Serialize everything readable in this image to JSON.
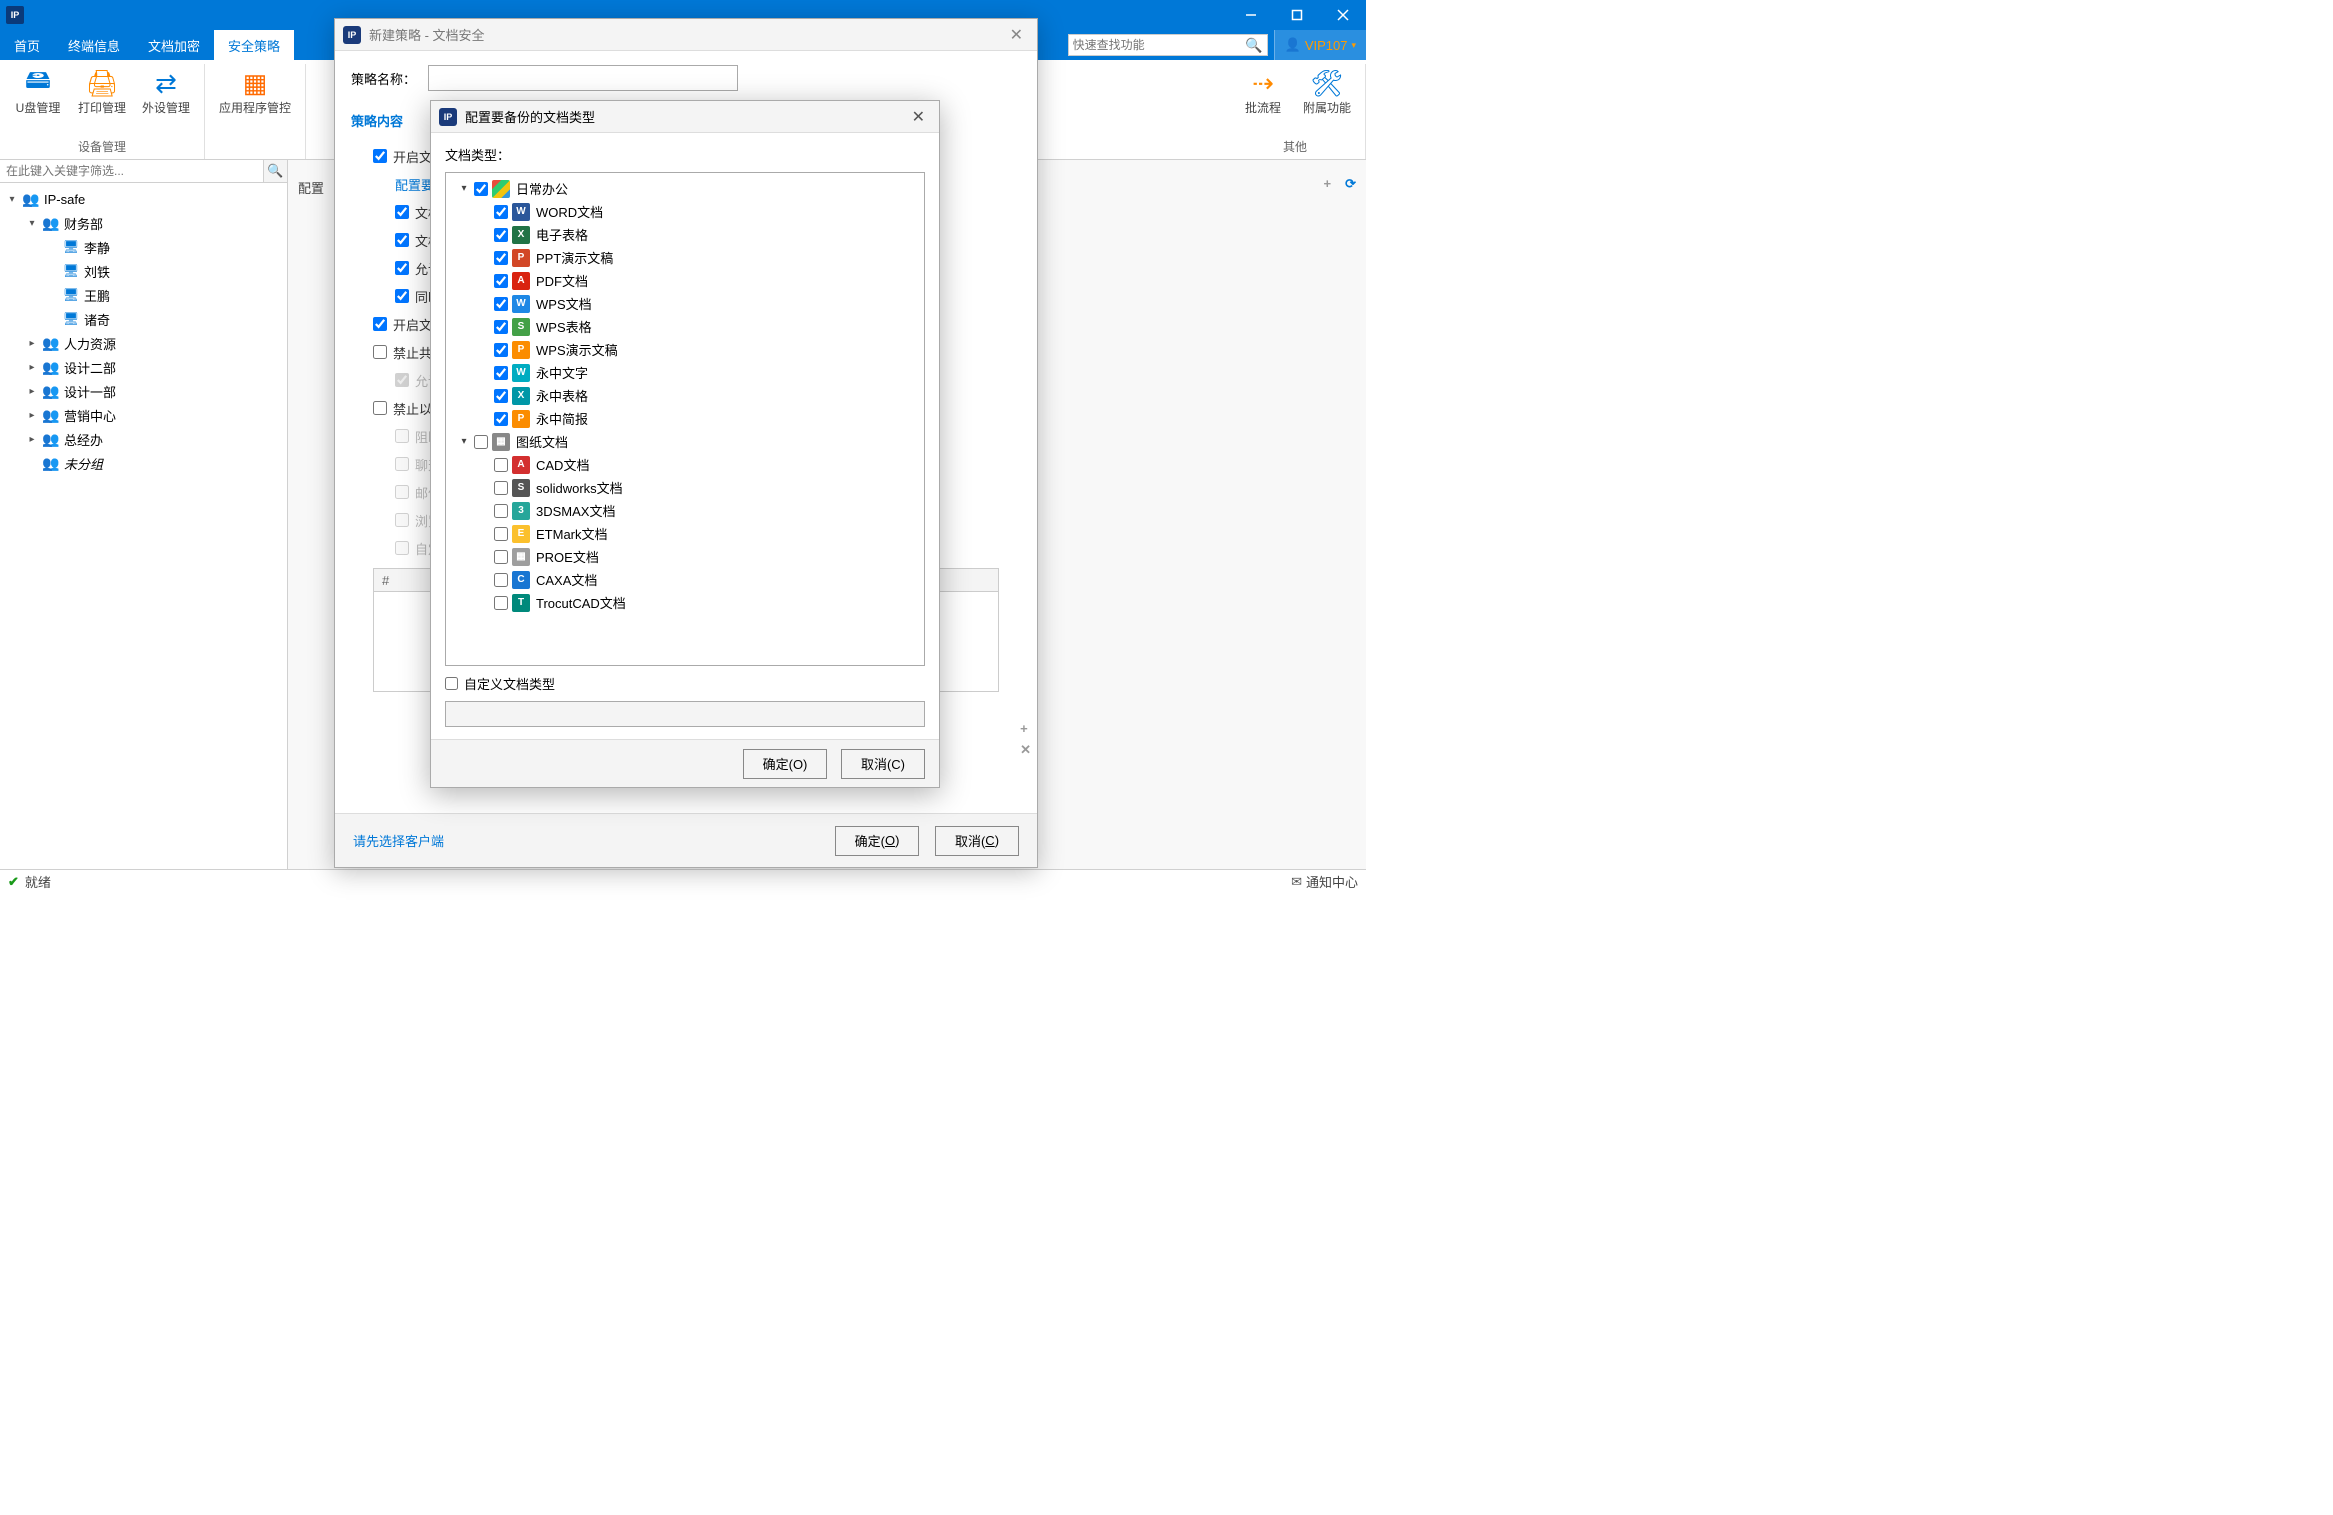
{
  "app": {
    "icon_text": "IP"
  },
  "menu": {
    "tabs": [
      "首页",
      "终端信息",
      "文档加密",
      "安全策略"
    ],
    "active_index": 3,
    "search_placeholder": "快速查找功能",
    "user": "VIP107"
  },
  "ribbon": {
    "groups": [
      {
        "label": "设备管理",
        "items": [
          {
            "icon": "🖴",
            "label": "U盘管理",
            "color": "#0078d7"
          },
          {
            "icon": "🖨",
            "label": "打印管理",
            "color": "#ff8a00"
          },
          {
            "icon": "⇄",
            "label": "外设管理",
            "color": "#0078d7"
          }
        ]
      },
      {
        "label": "",
        "items": [
          {
            "icon": "▦",
            "label": "应用程序管控",
            "color": "#ff6a00"
          }
        ],
        "cut": true
      },
      {
        "label": "其他",
        "items": [
          {
            "icon": "⇢",
            "label": "批流程",
            "color": "#ff8a00",
            "partial": true
          },
          {
            "icon": "🛠",
            "label": "附属功能",
            "color": "#0078d7"
          }
        ],
        "right": true
      }
    ]
  },
  "filter_placeholder": "在此键入关键字筛选...",
  "tree": {
    "root": "IP-safe",
    "root_children": [
      {
        "name": "财务部",
        "expanded": true,
        "children": [
          "李静",
          "刘铁",
          "王鹏",
          "诸奇"
        ]
      },
      {
        "name": "人力资源"
      },
      {
        "name": "设计二部"
      },
      {
        "name": "设计一部"
      },
      {
        "name": "营销中心"
      },
      {
        "name": "总经办"
      },
      {
        "name": "未分组",
        "italic": true,
        "no_twisty": true
      }
    ]
  },
  "center": {
    "cfg_label": "配置",
    "plus": "+",
    "refresh": "⟳"
  },
  "status": {
    "ready": "就绪",
    "notify": "通知中心"
  },
  "outer_modal": {
    "title": "新建策略 - 文档安全",
    "name_label": "策略名称：",
    "section": "策略内容",
    "rows": [
      {
        "lvl": 1,
        "checked": true,
        "text": "开启文"
      },
      {
        "lvl": 2,
        "link": true,
        "text": "配置要备"
      },
      {
        "lvl": 2,
        "checked": true,
        "text": "文档"
      },
      {
        "lvl": 2,
        "checked": true,
        "text": "文档"
      },
      {
        "lvl": 2,
        "checked": true,
        "text": "允许"
      },
      {
        "lvl": 2,
        "checked": true,
        "text": "同时"
      },
      {
        "lvl": 1,
        "checked": true,
        "text": "开启文"
      },
      {
        "lvl": 1,
        "checked": false,
        "text": "禁止共"
      },
      {
        "lvl": 2,
        "checked": true,
        "disabled": true,
        "text": "允许"
      },
      {
        "lvl": 1,
        "checked": false,
        "text": "禁止以"
      },
      {
        "lvl": 2,
        "checked": false,
        "disabled": true,
        "text": "阻断"
      },
      {
        "lvl": 2,
        "checked": false,
        "disabled": true,
        "text": "聊天"
      },
      {
        "lvl": 2,
        "checked": false,
        "disabled": true,
        "text": "邮件"
      },
      {
        "lvl": 2,
        "checked": false,
        "disabled": true,
        "text": "浏览"
      },
      {
        "lvl": 2,
        "checked": false,
        "disabled": true,
        "text": "自定"
      }
    ],
    "table_header": "#",
    "footer_hint": "请先选择客户端",
    "ok": "确定(",
    "ok_u": "O",
    "ok2": ")",
    "cancel": "取消(",
    "cancel_u": "C",
    "cancel2": ")"
  },
  "inner_modal": {
    "title": "配置要备份的文档类型",
    "label": "文档类型：",
    "custom_label": "自定义文档类型",
    "ok": "确定(O)",
    "cancel": "取消(C)",
    "nodes": [
      {
        "depth": 0,
        "twisty": "▾",
        "checked": true,
        "icon": "ic-multi",
        "text": "日常办公"
      },
      {
        "depth": 1,
        "checked": true,
        "icon": "ic-word",
        "glyph": "W",
        "text": "WORD文档"
      },
      {
        "depth": 1,
        "checked": true,
        "icon": "ic-xls",
        "glyph": "X",
        "text": "电子表格"
      },
      {
        "depth": 1,
        "checked": true,
        "icon": "ic-ppt",
        "glyph": "P",
        "text": "PPT演示文稿"
      },
      {
        "depth": 1,
        "checked": true,
        "icon": "ic-pdf",
        "glyph": "A",
        "text": "PDF文档"
      },
      {
        "depth": 1,
        "checked": true,
        "icon": "ic-wps",
        "glyph": "W",
        "text": "WPS文档"
      },
      {
        "depth": 1,
        "checked": true,
        "icon": "ic-wpss",
        "glyph": "S",
        "text": "WPS表格"
      },
      {
        "depth": 1,
        "checked": true,
        "icon": "ic-wpsp",
        "glyph": "P",
        "text": "WPS演示文稿"
      },
      {
        "depth": 1,
        "checked": true,
        "icon": "ic-yz1",
        "glyph": "W",
        "text": "永中文字"
      },
      {
        "depth": 1,
        "checked": true,
        "icon": "ic-yz2",
        "glyph": "X",
        "text": "永中表格"
      },
      {
        "depth": 1,
        "checked": true,
        "icon": "ic-yz3",
        "glyph": "P",
        "text": "永中简报"
      },
      {
        "depth": 0,
        "twisty": "▾",
        "checked": false,
        "icon": "ic-draw",
        "glyph": "▦",
        "text": "图纸文档"
      },
      {
        "depth": 1,
        "checked": false,
        "icon": "ic-cad",
        "glyph": "A",
        "text": "CAD文档"
      },
      {
        "depth": 1,
        "checked": false,
        "icon": "ic-sw",
        "glyph": "S",
        "text": "solidworks文档"
      },
      {
        "depth": 1,
        "checked": false,
        "icon": "ic-3ds",
        "glyph": "3",
        "text": "3DSMAX文档"
      },
      {
        "depth": 1,
        "checked": false,
        "icon": "ic-et",
        "glyph": "E",
        "text": "ETMark文档"
      },
      {
        "depth": 1,
        "checked": false,
        "icon": "ic-proe",
        "glyph": "▦",
        "text": "PROE文档"
      },
      {
        "depth": 1,
        "checked": false,
        "icon": "ic-caxa",
        "glyph": "C",
        "text": "CAXA文档"
      },
      {
        "depth": 1,
        "checked": false,
        "icon": "ic-tcad",
        "glyph": "T",
        "text": "TrocutCAD文档"
      }
    ]
  }
}
